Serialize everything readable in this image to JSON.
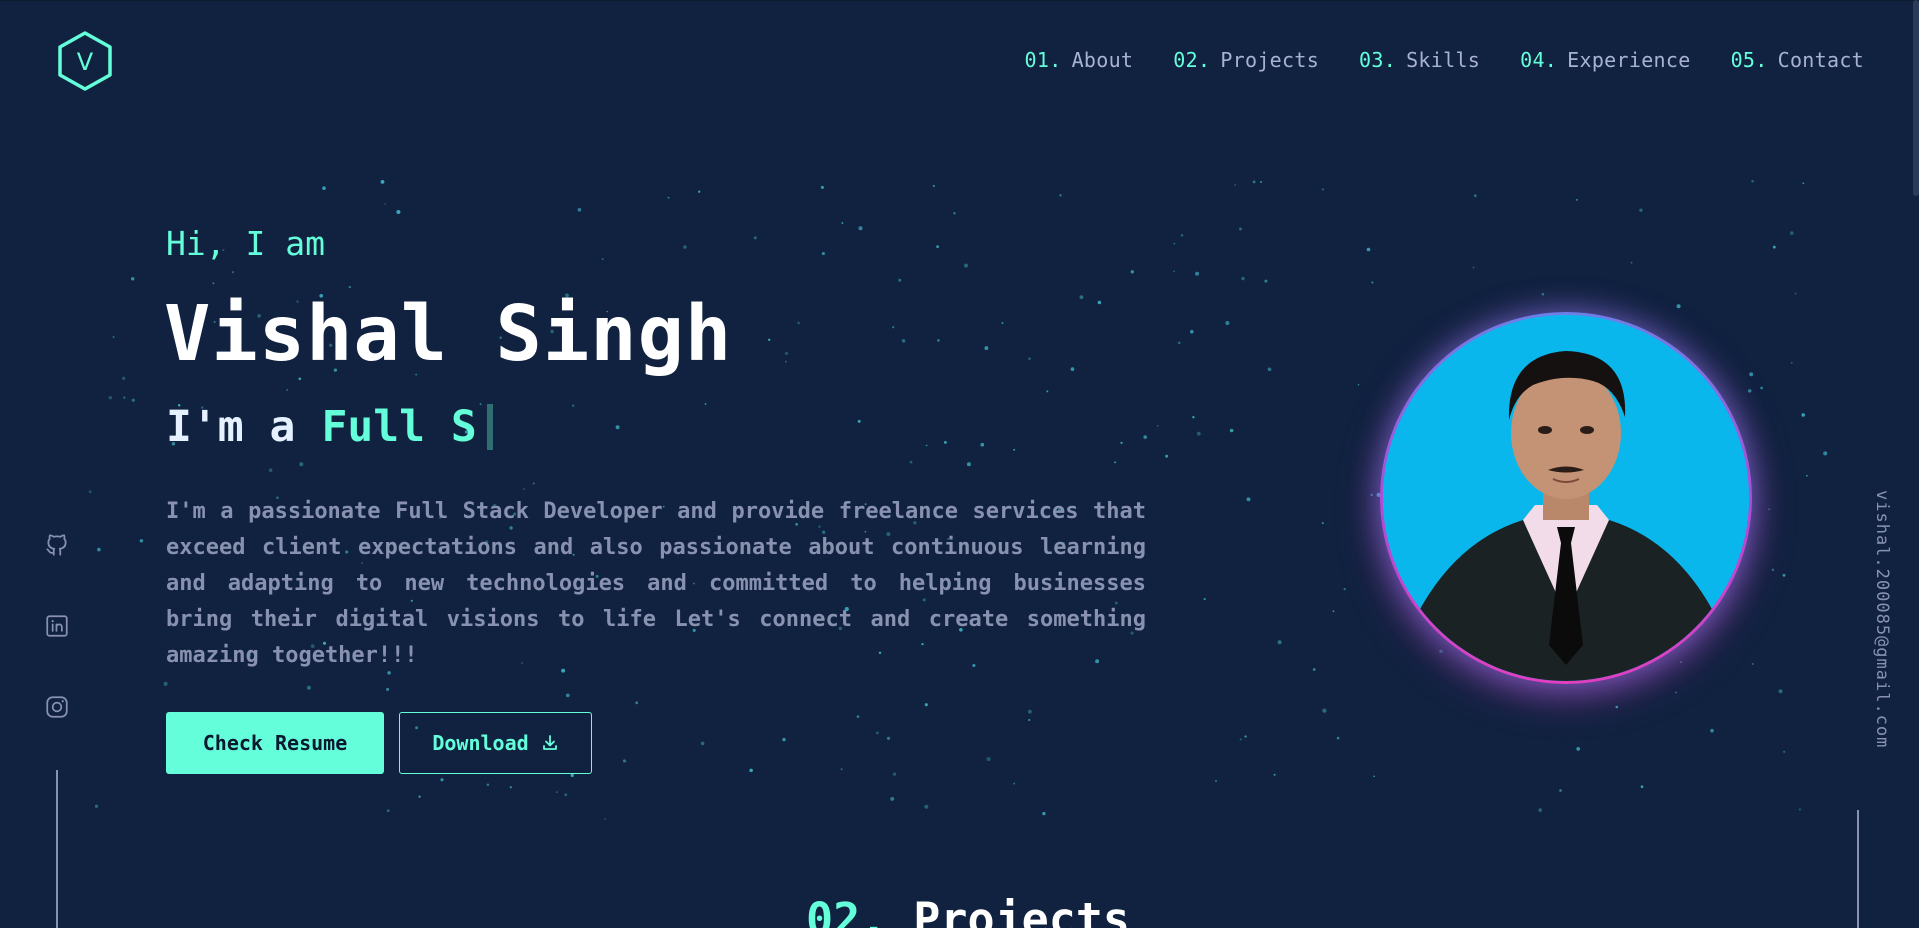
{
  "brand": {
    "logo_letter": "V"
  },
  "nav": {
    "items": [
      {
        "num": "01.",
        "label": "About"
      },
      {
        "num": "02.",
        "label": "Projects"
      },
      {
        "num": "03.",
        "label": "Skills"
      },
      {
        "num": "04.",
        "label": "Experience"
      },
      {
        "num": "05.",
        "label": "Contact"
      }
    ]
  },
  "hero": {
    "greeting": "Hi, I am",
    "name": "Vishal Singh",
    "typing_prefix": "I'm a",
    "typing_role": "Full S",
    "bio": "I'm a passionate Full Stack Developer and provide freelance services that exceed client expectations and also passionate about continuous learning and adapting to new technologies and committed to helping businesses bring their digital visions to life Let's connect and create something amazing together!!!",
    "primary_button": "Check Resume",
    "secondary_button": "Download"
  },
  "social": {
    "icons": [
      "github-icon",
      "linkedin-icon",
      "instagram-icon"
    ]
  },
  "email": "vishal.200085@gmail.com",
  "next_section": {
    "num": "02.",
    "title": "Projects"
  },
  "colors": {
    "background": "#112240",
    "accent": "#64ffda",
    "text_muted": "#8892b0",
    "nav_text": "#a8b2d1",
    "heading": "#ffffff",
    "avatar_bg": "#0ab7ec",
    "avatar_ring_top": "#6f7ee6",
    "avatar_ring_bottom": "#e040c2"
  }
}
